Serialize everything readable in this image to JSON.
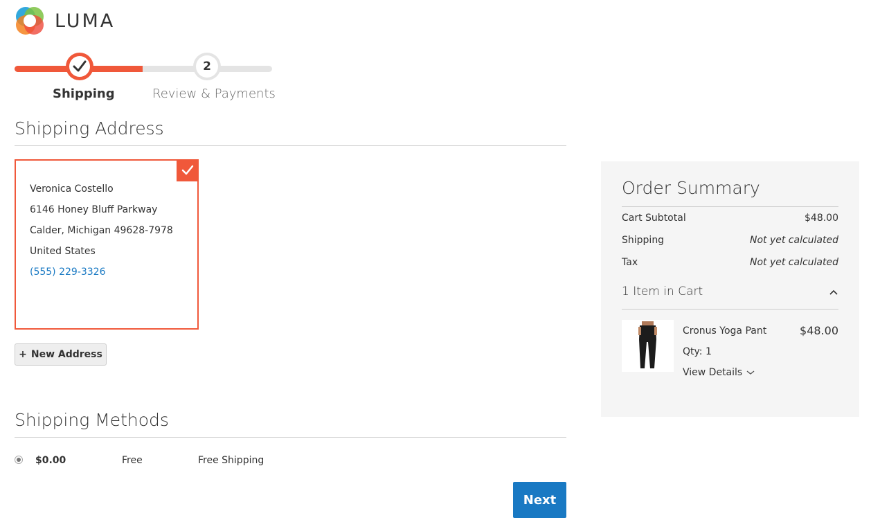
{
  "brand": {
    "name": "LUMA"
  },
  "progress": {
    "steps": [
      {
        "label": "Shipping",
        "state": "complete"
      },
      {
        "number": "2",
        "label": "Review & Payments",
        "state": "pending"
      }
    ]
  },
  "shipping_address": {
    "title": "Shipping Address",
    "selected_address": {
      "name": "Veronica Costello",
      "street": "6146 Honey Bluff Parkway",
      "city_line": "Calder, Michigan 49628-7978",
      "country": "United States",
      "phone": "(555) 229-3326"
    },
    "new_address_label": "New Address"
  },
  "shipping_methods": {
    "title": "Shipping Methods",
    "options": [
      {
        "price": "$0.00",
        "method": "Free",
        "carrier": "Free Shipping",
        "selected": true
      }
    ],
    "next_label": "Next"
  },
  "order_summary": {
    "title": "Order Summary",
    "rows": [
      {
        "label": "Cart Subtotal",
        "value": "$48.00"
      },
      {
        "label": "Shipping",
        "value": "Not yet calculated"
      },
      {
        "label": "Tax",
        "value": "Not yet calculated"
      }
    ],
    "items_label": "1 Item in Cart",
    "items": [
      {
        "name": "Cronus Yoga Pant",
        "price": "$48.00",
        "qty": "Qty: 1",
        "details_label": "View Details"
      }
    ]
  },
  "colors": {
    "accent": "#f0583a",
    "primary_button": "#1979c3",
    "link": "#1979c3",
    "summary_bg": "#f5f5f5"
  }
}
